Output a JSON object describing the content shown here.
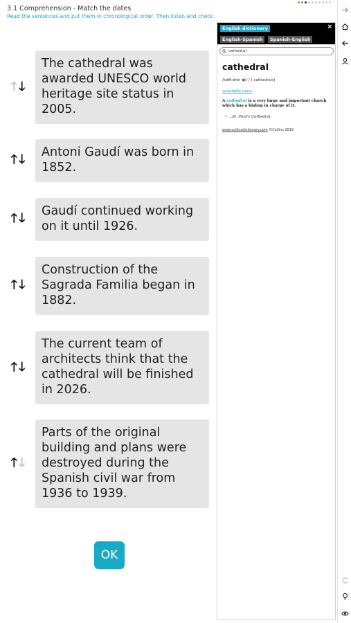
{
  "header": {
    "title": "3.1 Comprehension - Match the dates",
    "instructions": "Read the sentences and put them in chronological order. Then listen and check."
  },
  "progress": {
    "current_index": 2,
    "total": 10,
    "completed": 2
  },
  "sentences": [
    {
      "text": "The cathedral was awarded UNESCO world heritage site status in 2005.",
      "up_enabled": false,
      "down_enabled": true
    },
    {
      "text": "Antoni Gaudí was born in 1852.",
      "up_enabled": true,
      "down_enabled": true
    },
    {
      "text": "Gaudí continued working on it until 1926.",
      "up_enabled": true,
      "down_enabled": true
    },
    {
      "text": "Construction of the Sagrada Familia began in 1882.",
      "up_enabled": true,
      "down_enabled": true
    },
    {
      "text": "The current team of architects think that the cathedral will be finished in 2026.",
      "up_enabled": true,
      "down_enabled": true
    },
    {
      "text": "Parts of the original building and plans were destroyed during the Spanish civil war from 1936 to 1939.",
      "up_enabled": true,
      "down_enabled": false
    }
  ],
  "arrows": {
    "up": "🡑",
    "down": "🡓"
  },
  "ok_button": {
    "label": "OK"
  },
  "dictionary": {
    "tabs": [
      "English dictionary",
      "English-Spanish",
      "Spanish-English"
    ],
    "close": "×",
    "search_value": "cathedral",
    "headword": "cathedral",
    "pronunciation": "/kəθiːdrəl ◀)) / ( cathedrals)",
    "part_of_speech": "countable noun",
    "definition_prefix": "A ",
    "definition_headword": "cathedral",
    "definition_rest": " is a very large and important church which has a bishop in charge of it.",
    "example": "• ...St. Paul's Cathedral.",
    "source_link": "www.collinsdictionary.com",
    "source_copyright": " ©Collins 2019"
  },
  "sidebar": [
    "forward-arrow-icon",
    "home-icon",
    "back-arrow-icon",
    "users-icon",
    "undo-icon",
    "hint-bulb-icon",
    "eye-icon"
  ],
  "colors": {
    "accent": "#1aa5c8",
    "card_bg": "#e5e5e5",
    "ok_bg": "#1ba9c8"
  }
}
